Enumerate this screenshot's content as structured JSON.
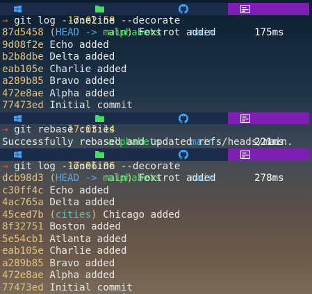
{
  "prompts": [
    {
      "time": "17:02:58",
      "dir": "alphabets",
      "branch": "main",
      "duration": "175ms"
    },
    {
      "time": "17:03:14",
      "dir": "alphabets",
      "branch": "main",
      "duration": "221ms"
    },
    {
      "time": "17:06:06",
      "dir": "alphabets",
      "branch": "main",
      "duration": "278ms"
    }
  ],
  "commands": [
    "git log --oneline --decorate",
    "git rebase cities",
    "git log --oneline --decorate"
  ],
  "log1": [
    {
      "hash": "87d5458",
      "msg": "Foxtrot added"
    },
    {
      "hash": "9d08f2e",
      "msg": "Echo added"
    },
    {
      "hash": "b2b8dbe",
      "msg": "Delta added"
    },
    {
      "hash": "eab105e",
      "msg": "Charlie added"
    },
    {
      "hash": "a289b85",
      "msg": "Bravo added"
    },
    {
      "hash": "472e8ae",
      "msg": "Alpha added"
    },
    {
      "hash": "77473ed",
      "msg": "Initial commit"
    }
  ],
  "log1_decor": {
    "open": "(",
    "head": "HEAD -> ",
    "branch": "main",
    "close": ")"
  },
  "rebase_output": "Successfully rebased and updated refs/heads/main.",
  "log2": [
    {
      "hash": "dcb98d3",
      "msg": "Foxtrot added"
    },
    {
      "hash": "c30ff4c",
      "msg": "Echo added"
    },
    {
      "hash": "4ac765a",
      "msg": "Delta added"
    },
    {
      "hash": "45ced7b",
      "msg": "Chicago added"
    },
    {
      "hash": "8f32751",
      "msg": "Boston added"
    },
    {
      "hash": "5e54cb1",
      "msg": "Atlanta added"
    },
    {
      "hash": "eab105e",
      "msg": "Charlie added"
    },
    {
      "hash": "a289b85",
      "msg": "Bravo added"
    },
    {
      "hash": "472e8ae",
      "msg": "Alpha added"
    },
    {
      "hash": "77473ed",
      "msg": "Initial commit"
    }
  ],
  "log2_decor": {
    "open": "(",
    "head": "HEAD -> ",
    "branch": "main",
    "close": ")"
  },
  "log2_cities_decor": {
    "open": "(",
    "branch": "cities",
    "close": ")"
  },
  "icons": {
    "os": "windows-icon",
    "clock": "clock-icon",
    "folder": "folder-icon",
    "git": "github-icon",
    "timer": "timer-icon",
    "prompt_arrow": "→"
  },
  "colors": {
    "prompt_bg": "#1b2b4a",
    "duration_bg": "#7d1fb3",
    "time": "#f0d060",
    "dir": "#40e060",
    "branch": "#3aa8ff",
    "hash": "#e6c07b",
    "arrow": "#ff4a3a"
  }
}
